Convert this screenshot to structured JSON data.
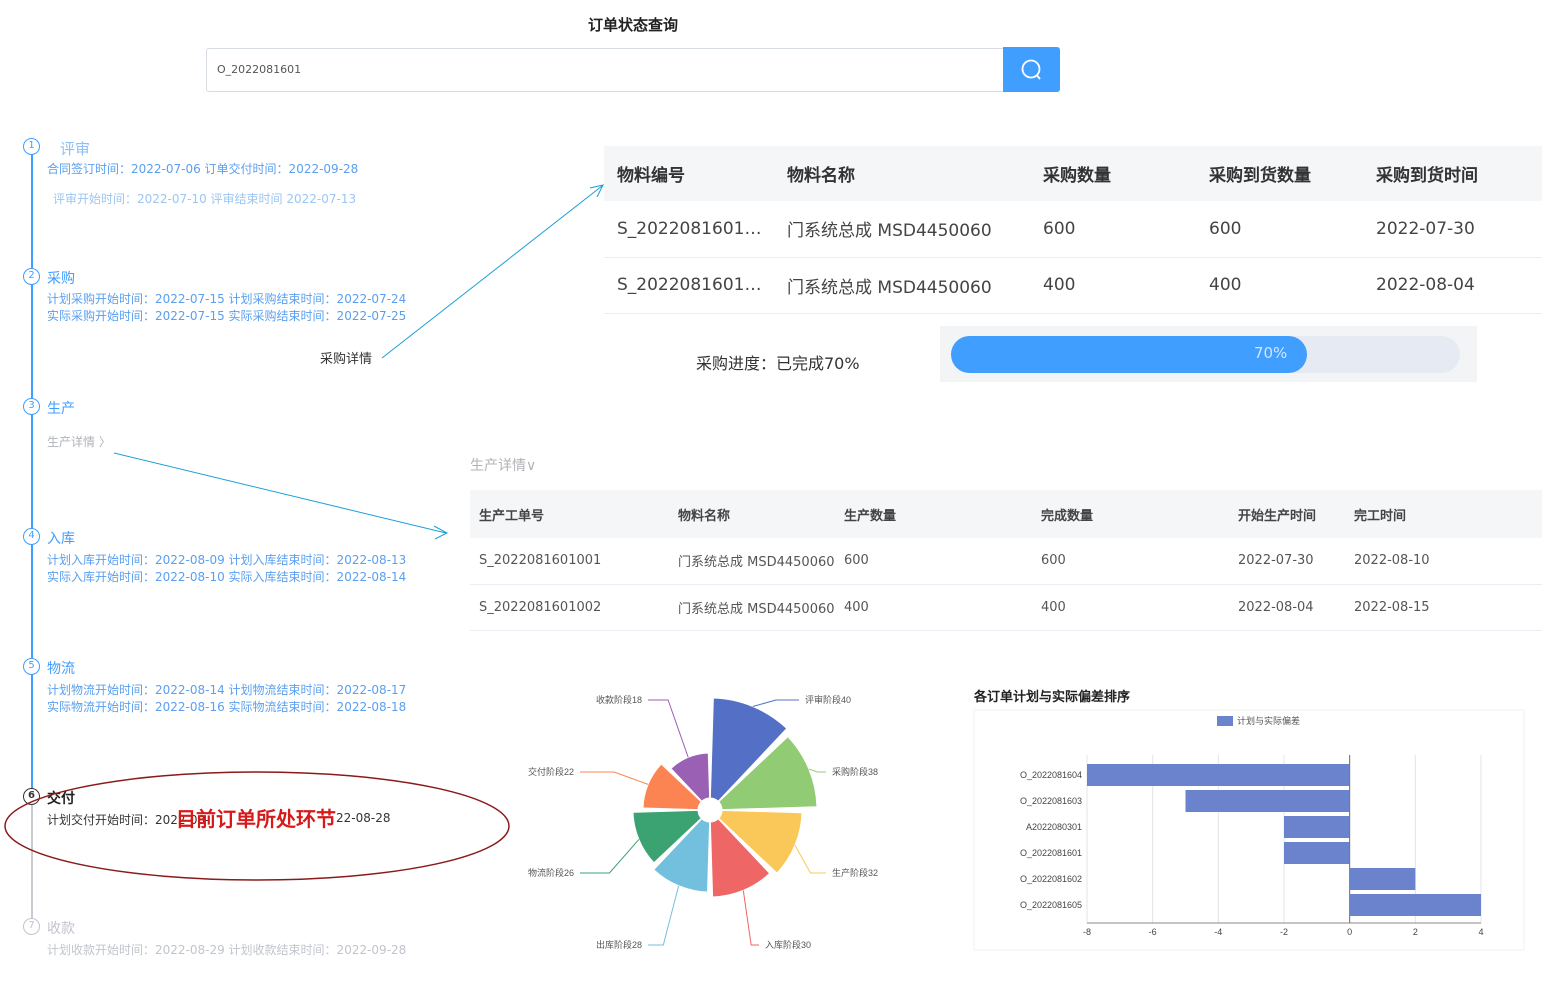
{
  "header": {
    "title": "订单状态查询"
  },
  "search": {
    "value": "O_2022081601",
    "button_icon": "search-icon"
  },
  "timeline": {
    "steps": [
      {
        "no": "1",
        "title": "评审",
        "line1": "合同签订时间：2022-07-06     订单交付时间：2022-09-28",
        "line2": "评审开始时间：2022-07-10 评审结束时间 2022-07-13"
      },
      {
        "no": "2",
        "title": "采购",
        "line1": "计划采购开始时间：2022-07-15     计划采购结束时间：2022-07-24",
        "line2": "实际采购开始时间：2022-07-15     实际采购结束时间：2022-07-25",
        "link": "采购详情"
      },
      {
        "no": "3",
        "title": "生产",
        "link": "生产详情 〉"
      },
      {
        "no": "4",
        "title": "入库",
        "line1": "计划入库开始时间：2022-08-09     计划入库结束时间：2022-08-13",
        "line2": "实际入库开始时间：2022-08-10     实际入库结束时间：2022-08-14"
      },
      {
        "no": "5",
        "title": "物流",
        "line1": "计划物流开始时间：2022-08-14     计划物流结束时间：2022-08-17",
        "line2": "实际物流开始时间：2022-08-16     实际物流结束时间：2022-08-18"
      },
      {
        "no": "6",
        "title": "交付",
        "line1a": "计划交付开始时间：2022-08-",
        "line1b": "22-08-28"
      },
      {
        "no": "7",
        "title": "收款",
        "line1": "计划收款开始时间：2022-08-29     计划收款结束时间：2022-09-28"
      }
    ],
    "annotation": "目前订单所处环节"
  },
  "purchase": {
    "headers": [
      "物料编号",
      "物料名称",
      "采购数量",
      "采购到货数量",
      "采购到货时间"
    ],
    "rows": [
      [
        "S_2022081601…",
        "门系统总成 MSD4450060",
        "600",
        "600",
        "2022-07-30"
      ],
      [
        "S_2022081601…",
        "门系统总成 MSD4450060",
        "400",
        "400",
        "2022-08-04"
      ]
    ],
    "progress_label": "采购进度：已完成70%",
    "progress_value": 70,
    "progress_text": "70%"
  },
  "production": {
    "toggle": "生产详情∨",
    "headers": [
      "生产工单号",
      "物料名称",
      "生产数量",
      "完成数量",
      "开始生产时间",
      "完工时间"
    ],
    "rows": [
      [
        "S_2022081601001",
        "门系统总成 MSD4450060",
        "600",
        "600",
        "2022-07-30",
        "2022-08-10"
      ],
      [
        "S_2022081601002",
        "门系统总成 MSD4450060",
        "400",
        "400",
        "2022-08-04",
        "2022-08-15"
      ]
    ]
  },
  "chart_data": [
    {
      "type": "pie",
      "subtype": "rose",
      "categories": [
        "评审阶段",
        "采购阶段",
        "生产阶段",
        "入库阶段",
        "出库阶段",
        "物流阶段",
        "交付阶段",
        "收款阶段"
      ],
      "values": [
        40,
        38,
        32,
        30,
        28,
        26,
        22,
        18
      ],
      "labels": [
        "评审阶段40",
        "采购阶段38",
        "生产阶段32",
        "入库阶段30",
        "出库阶段28",
        "物流阶段26",
        "交付阶段22",
        "收款阶段18"
      ],
      "colors": [
        "#5470c6",
        "#91cc75",
        "#fac858",
        "#ee6666",
        "#73c0de",
        "#3ba272",
        "#fc8452",
        "#9a60b4"
      ]
    },
    {
      "type": "bar",
      "orientation": "horizontal",
      "title": "各订单计划与实际偏差排序",
      "legend": "计划与实际偏差",
      "categories": [
        "O_2022081604",
        "O_2022081603",
        "A2022080301",
        "O_2022081601",
        "O_2022081602",
        "O_2022081605"
      ],
      "values": [
        -8,
        -5,
        -2,
        -2,
        2,
        4
      ],
      "xlim": [
        -8,
        4
      ],
      "xticks": [
        "-8",
        "-6",
        "-4",
        "-2",
        "0",
        "2",
        "4"
      ],
      "color": "#6b82cc"
    }
  ]
}
